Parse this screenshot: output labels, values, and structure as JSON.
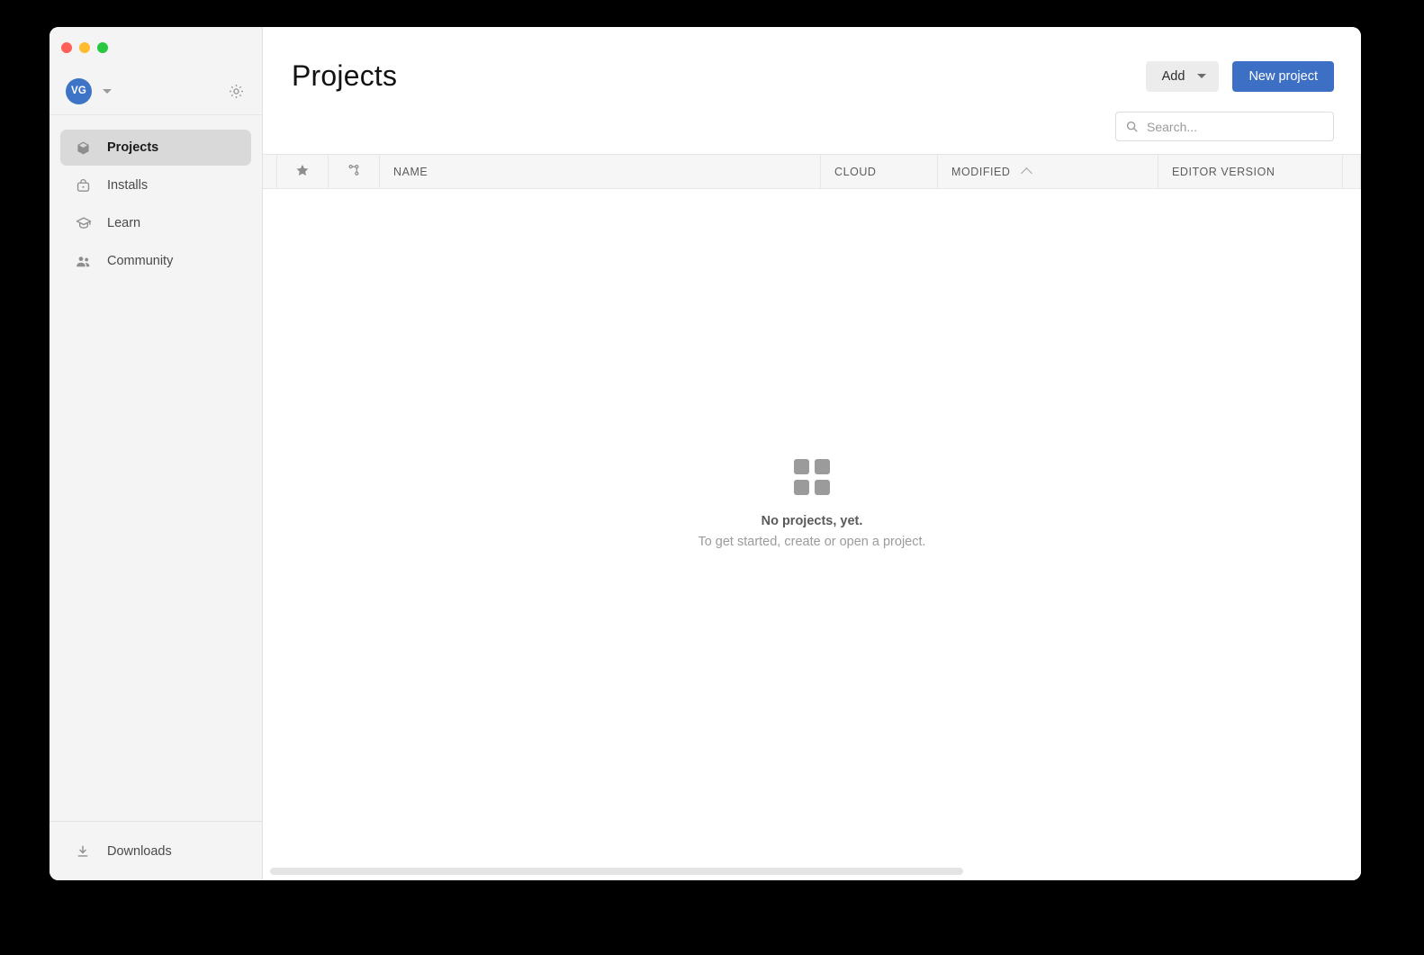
{
  "window": {
    "traffic_lights": [
      {
        "name": "close",
        "color": "#ff5f57"
      },
      {
        "name": "minimize",
        "color": "#febc2e"
      },
      {
        "name": "maximize",
        "color": "#28c840"
      }
    ]
  },
  "sidebar": {
    "account": {
      "avatar_initials": "VG",
      "caret_icon": "chevron-down-icon",
      "settings_icon": "gear-icon"
    },
    "items": [
      {
        "label": "Projects",
        "icon": "cube-icon",
        "active": true
      },
      {
        "label": "Installs",
        "icon": "installs-icon",
        "active": false
      },
      {
        "label": "Learn",
        "icon": "graduation-cap-icon",
        "active": false
      },
      {
        "label": "Community",
        "icon": "people-icon",
        "active": false
      }
    ],
    "downloads": {
      "label": "Downloads",
      "icon": "download-icon"
    }
  },
  "header": {
    "title": "Projects",
    "add_label": "Add",
    "add_caret_icon": "chevron-down-icon",
    "new_project_label": "New project"
  },
  "search": {
    "placeholder": "Search...",
    "value": "",
    "icon": "search-icon"
  },
  "table": {
    "columns": [
      {
        "key": "favorite",
        "label": "",
        "icon": "star-icon"
      },
      {
        "key": "version_control",
        "label": "",
        "icon": "git-branch-icon"
      },
      {
        "key": "name",
        "label": "NAME",
        "icon": null
      },
      {
        "key": "cloud",
        "label": "CLOUD",
        "icon": null
      },
      {
        "key": "modified",
        "label": "MODIFIED",
        "icon": "sort-asc-icon"
      },
      {
        "key": "editor_version",
        "label": "EDITOR VERSION",
        "icon": null
      }
    ],
    "sort": {
      "column": "MODIFIED",
      "direction": "ascending"
    },
    "rows": []
  },
  "empty_state": {
    "icon": "grid-squares-icon",
    "title": "No projects, yet.",
    "subtitle": "To get started, create or open a project."
  },
  "colors": {
    "accent_blue": "#3d6fc4",
    "sidebar_bg": "#f4f4f4",
    "active_item_bg": "#d9d9d9",
    "table_header_bg": "#f6f6f6"
  }
}
